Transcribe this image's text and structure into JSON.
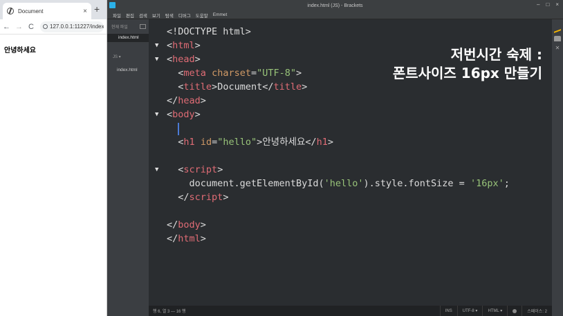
{
  "browser": {
    "tab_title": "Document",
    "tab_close": "×",
    "new_tab": "+",
    "back": "←",
    "forward": "→",
    "reload": "C",
    "address": "127.0.0.1:11227/index",
    "heading": "안녕하세요"
  },
  "brackets": {
    "window_title": "index.html (JS) - Brackets",
    "window_controls": [
      "–",
      "□",
      "×"
    ],
    "menu": [
      "파일",
      "편집",
      "검색",
      "보기",
      "탐색",
      "디버그",
      "도움말",
      "Emmet"
    ],
    "sidebar": {
      "working_files_label": "현재 파일",
      "active_file": "index.html",
      "project_label": "JS ▾",
      "project_file": "index.html"
    },
    "overlay": {
      "line1": "저번시간 숙제 :",
      "line2": "폰트사이즈 16px 만들기"
    },
    "status": {
      "position": "행 6, 열 3 — 16 행",
      "mode": "INS",
      "encoding": "UTF-8 ▾",
      "language": "HTML ▾",
      "spaces": "스페이스: 2"
    }
  },
  "code": {
    "l1": "<!DOCTYPE html>",
    "l2_tag": "html",
    "l3_tag": "head",
    "l4_tag": "meta",
    "l4_attr": "charset",
    "l4_val": "\"UTF-8\"",
    "l5_tag": "title",
    "l5_text": "Document",
    "l6_tag": "head",
    "l7_tag": "body",
    "l9_tag": "h1",
    "l9_attr": "id",
    "l9_val": "\"hello\"",
    "l9_text": "안녕하세요",
    "l11_tag": "script",
    "l12_pre": "document.getElementById(",
    "l12_str1": "'hello'",
    "l12_mid": ").style.fontSize = ",
    "l12_str2": "'16px'",
    "l12_end": ";",
    "l13_tag": "script",
    "l15_tag": "body",
    "l16_tag": "html"
  }
}
